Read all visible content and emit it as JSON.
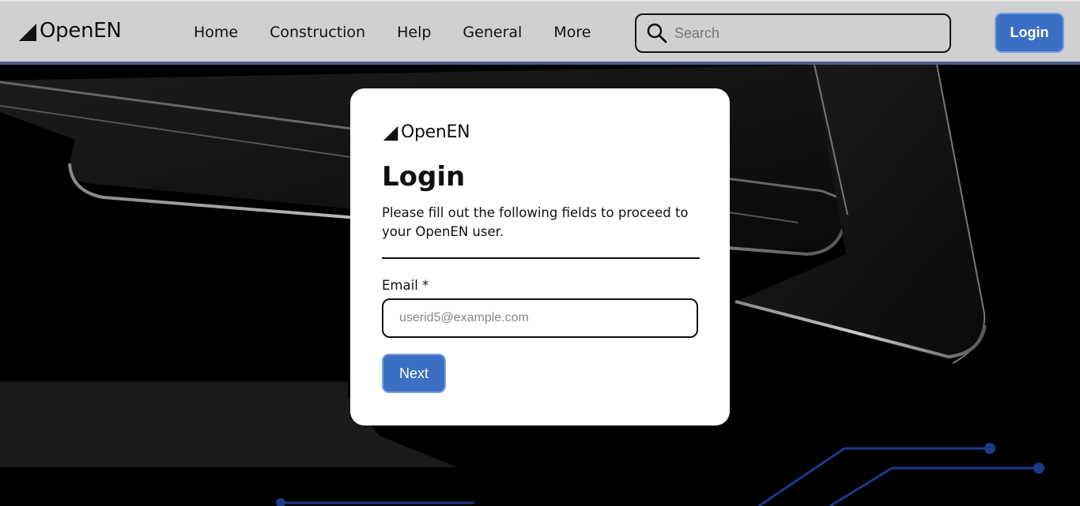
{
  "header": {
    "brand": "OpenEN",
    "nav": [
      "Home",
      "Construction",
      "Help",
      "General",
      "More"
    ],
    "search_placeholder": "Search",
    "login_label": "Login"
  },
  "card": {
    "brand": "OpenEN",
    "title": "Login",
    "description": "Please fill out the following fields to proceed to your OpenEN user.",
    "email_label": "Email *",
    "email_placeholder": "userid5@example.com",
    "next_label": "Next"
  },
  "colors": {
    "accent": "#3a6fc4",
    "header_bg": "#d0d0d0",
    "header_border": "#4a5a8a",
    "circuit": "#1a3a8a"
  }
}
